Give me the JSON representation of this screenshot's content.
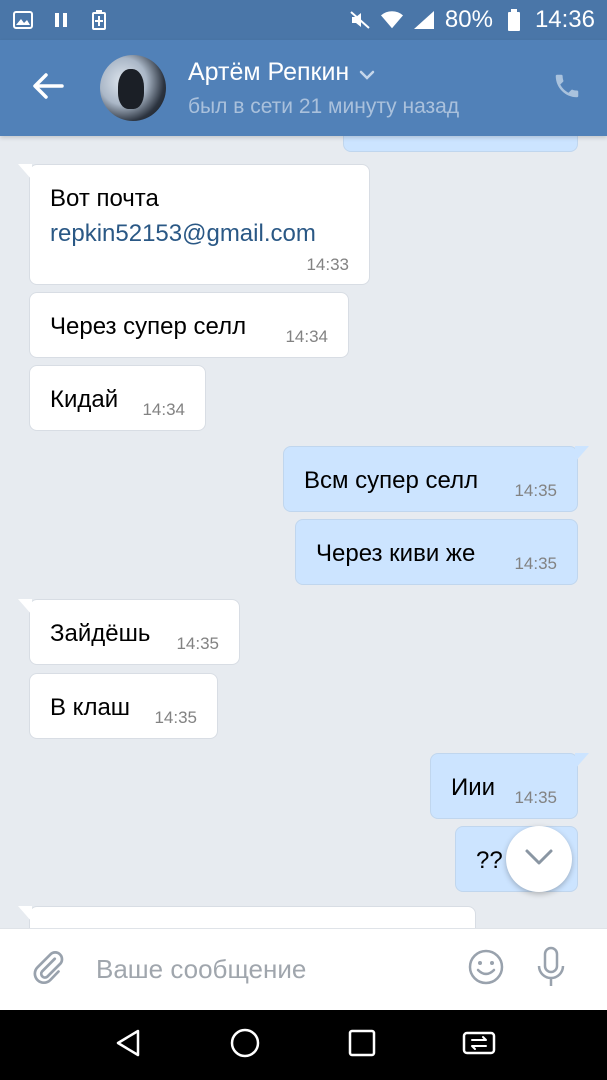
{
  "status_bar": {
    "battery": "80%",
    "time": "14:36"
  },
  "header": {
    "name": "Артём Репкин",
    "status": "был в сети 21 минуту назад"
  },
  "messages": [
    {
      "dir": "in",
      "lines": [
        "Вот почта"
      ],
      "link": "repkin52153@gmail.com",
      "time": "14:33"
    },
    {
      "dir": "in",
      "text": "Через супер селл",
      "time": "14:34"
    },
    {
      "dir": "in",
      "text": "Кидай",
      "time": "14:34"
    },
    {
      "dir": "out",
      "text": "Всм супер селл",
      "time": "14:35"
    },
    {
      "dir": "out",
      "text": "Через киви же",
      "time": "14:35"
    },
    {
      "dir": "in",
      "text": "Зайдёшь",
      "time": "14:35"
    },
    {
      "dir": "in",
      "text": "В клаш",
      "time": "14:35"
    },
    {
      "dir": "out",
      "text": "Иии",
      "time": "14:35"
    },
    {
      "dir": "out",
      "text": "??",
      "time": ""
    }
  ],
  "composer": {
    "placeholder": "Ваше сообщение"
  },
  "icons": {
    "back": "arrow-left-icon",
    "call": "phone-icon",
    "attach": "paperclip-icon",
    "emoji": "smiley-icon",
    "mic": "microphone-icon",
    "scroll": "chevron-down-icon"
  },
  "colors": {
    "header": "#5181b8",
    "statusbar": "#4a76a8",
    "chat_bg": "#e7ebf0",
    "bubble_out": "#cce4ff",
    "link": "#2a5885"
  }
}
